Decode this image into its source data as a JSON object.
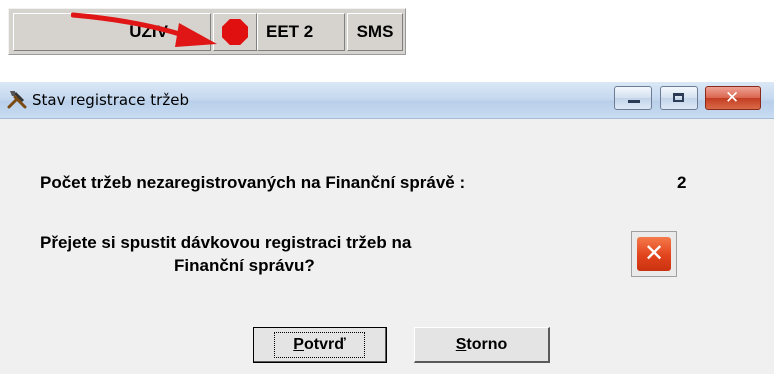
{
  "statusbar": {
    "uziv_label": "UZIV",
    "status_color": "#e01010",
    "eet_label": "EET 2",
    "sms_label": "SMS",
    "arrow_color": "#e01515"
  },
  "dialog": {
    "title": "Stav registrace tržeb",
    "icon": "tools-hammer-icon",
    "count_label": "Počet tržeb nezaregistrovaných na Finanční správě :",
    "count_value": "2",
    "question_line1": "Přejete si spustit dávkovou registraci tržeb na",
    "question_line2": "Finanční správu?",
    "confirm_first": "P",
    "confirm_rest": "otvrď",
    "cancel_first": "S",
    "cancel_rest": "torno"
  }
}
